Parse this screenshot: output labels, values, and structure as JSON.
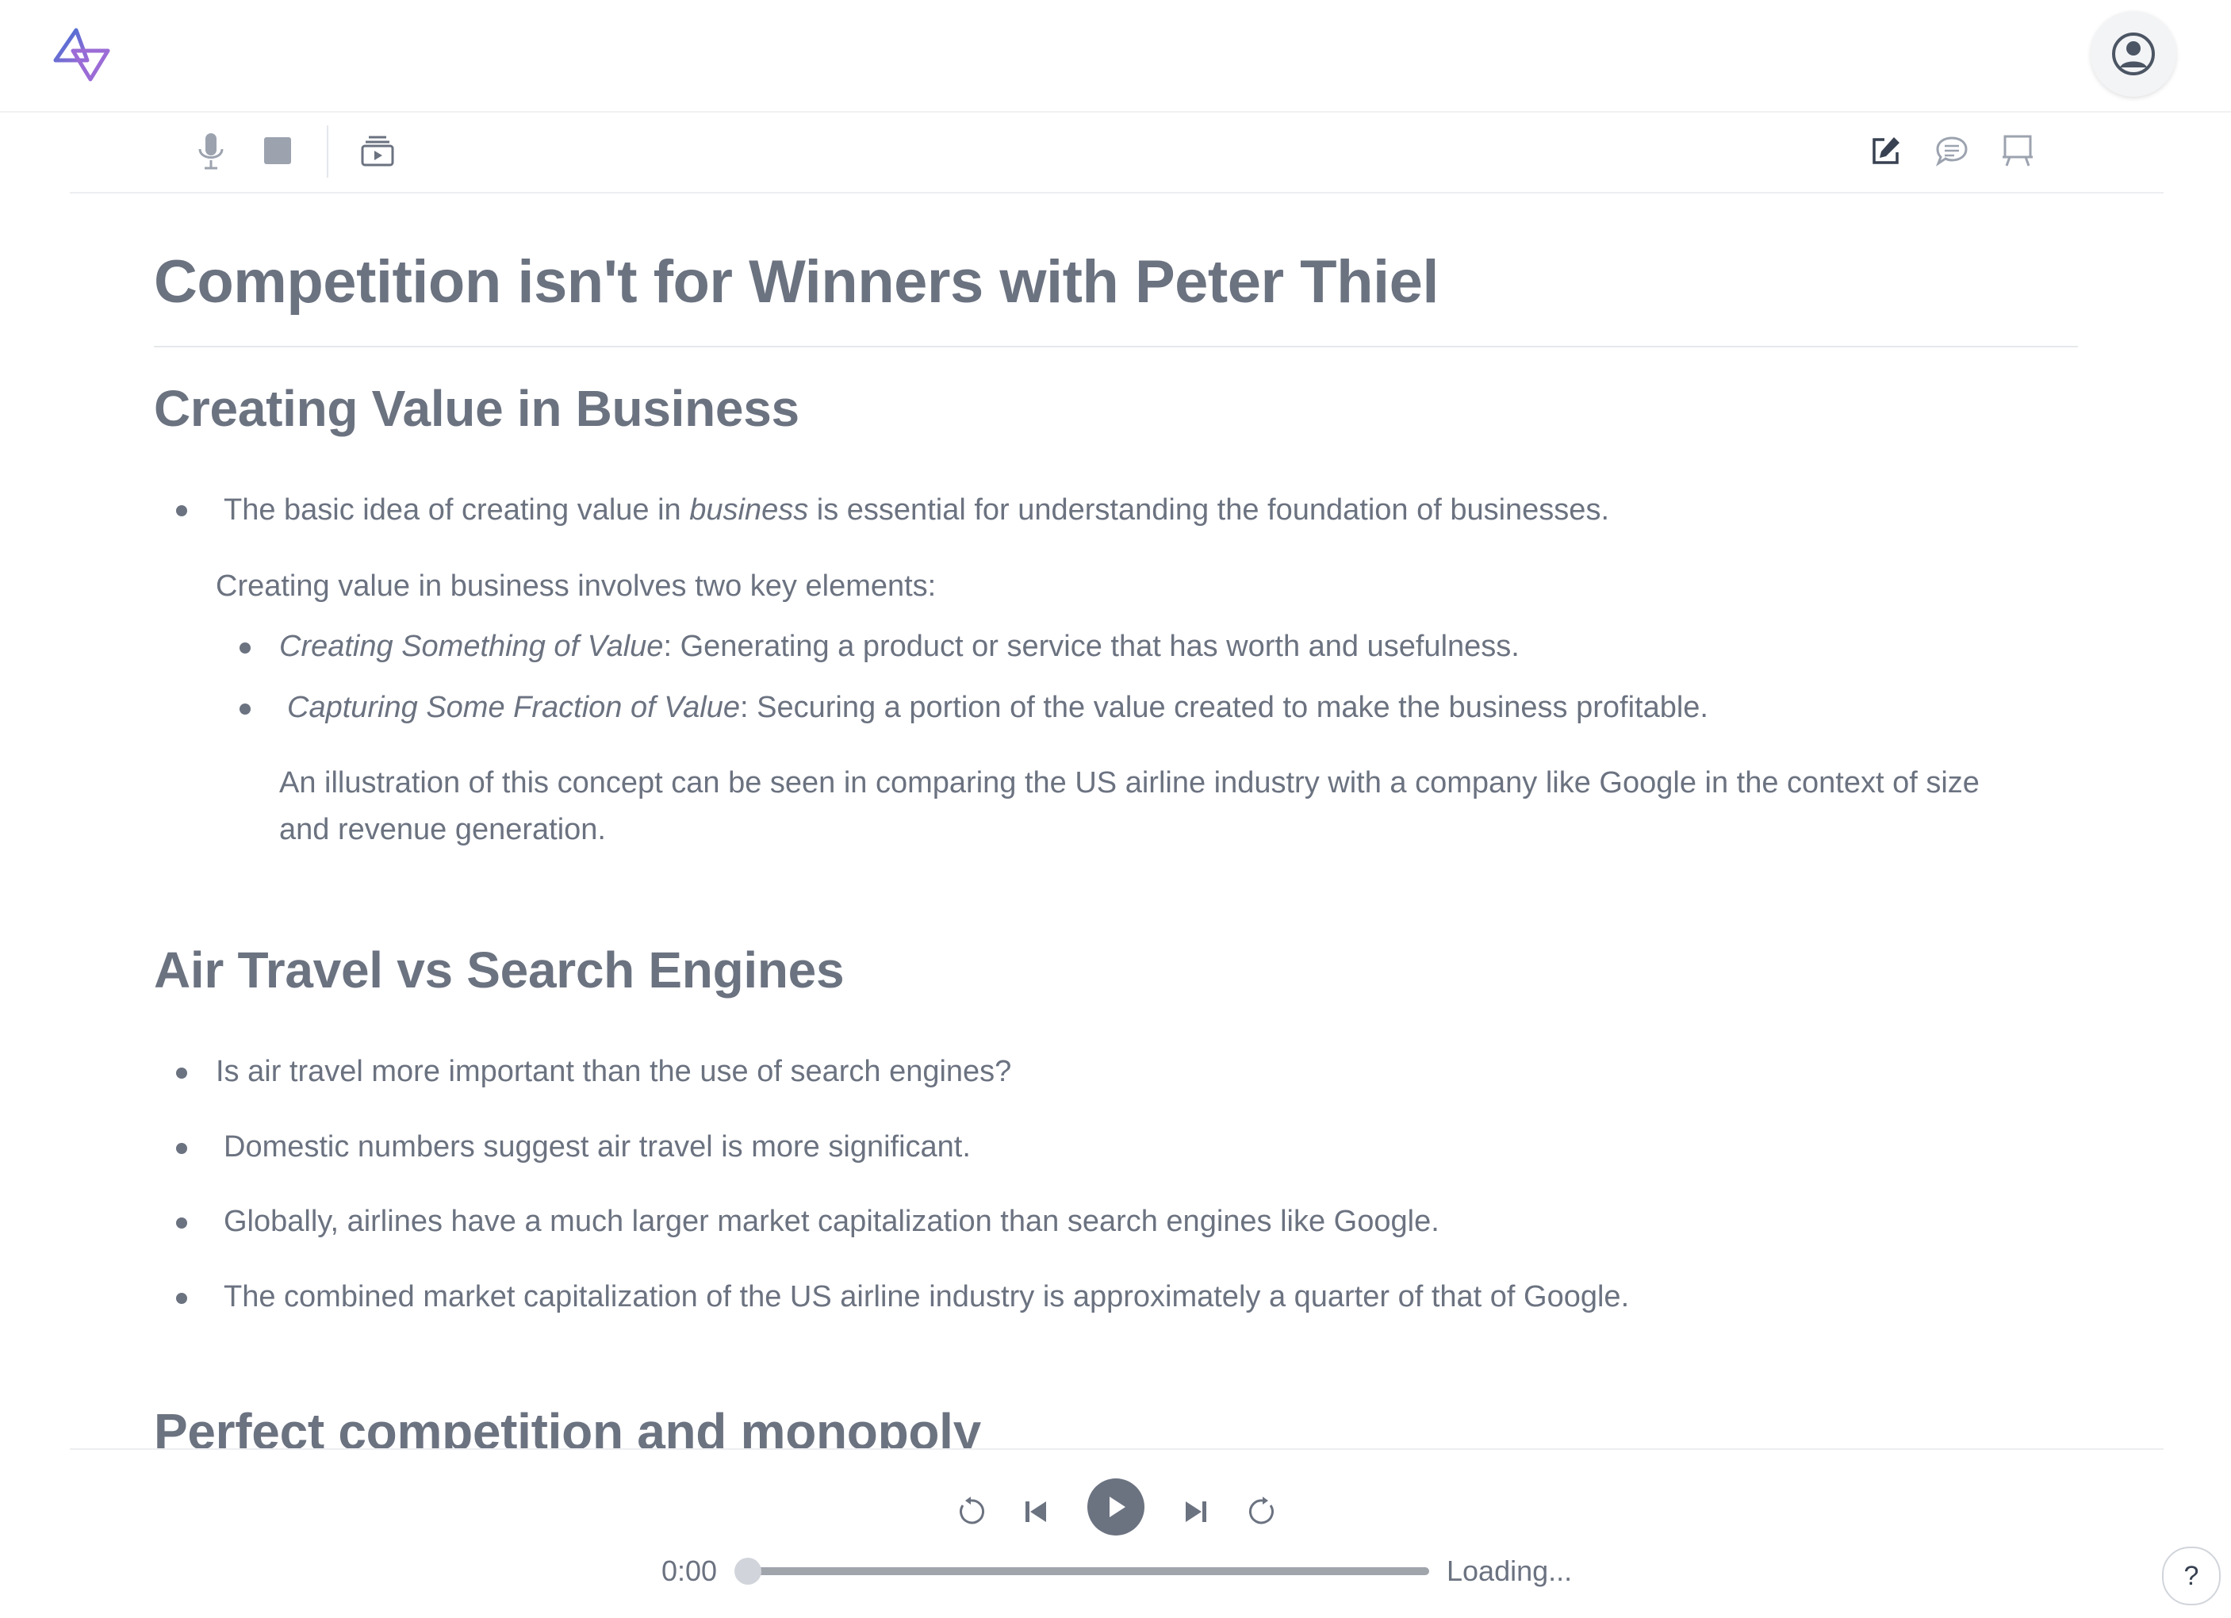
{
  "document": {
    "title": "Competition isn't for Winners with Peter Thiel"
  },
  "sections": [
    {
      "heading": "Creating Value in Business",
      "bullet1": {
        "pre": "The basic idea of creating value in ",
        "em": "business",
        "post": " is essential for understanding the foundation of businesses."
      },
      "intro": "Creating value in business involves two key elements:",
      "sub": [
        {
          "em": "Creating Something of Value",
          "rest": ": Generating a product or service that has worth and usefulness."
        },
        {
          "em": "Capturing Some Fraction of Value",
          "rest": ": Securing a portion of the value created to make the business profitable."
        }
      ],
      "illustration_line1": "An illustration of this concept can be seen in comparing the US airline industry with a company like Google in the context of size",
      "illustration_line2": "and revenue generation."
    },
    {
      "heading": "Air Travel vs Search Engines",
      "bullets": [
        "Is air travel more important than the use of search engines?",
        "Domestic numbers suggest air travel is more significant.",
        "Globally, airlines have a much larger market capitalization than search engines like Google.",
        "The combined market capitalization of the US airline industry is approximately a quarter of that of Google."
      ]
    },
    {
      "heading": "Perfect competition and monopoly"
    }
  ],
  "player": {
    "current_time": "0:00",
    "status": "Loading...",
    "progress": 0
  },
  "help": {
    "label": "?"
  },
  "icons": {
    "logo": "app-logo",
    "profile": "user-circle-icon",
    "mic": "microphone-icon",
    "stop": "stop-icon",
    "slides": "slideshow-icon",
    "edit": "edit-icon",
    "chat": "chat-icon",
    "presentation": "presentation-icon"
  },
  "colors": {
    "text": "#6b7280",
    "accent_blue": "#3b6fd1",
    "accent_purple": "#9b6cd6"
  }
}
